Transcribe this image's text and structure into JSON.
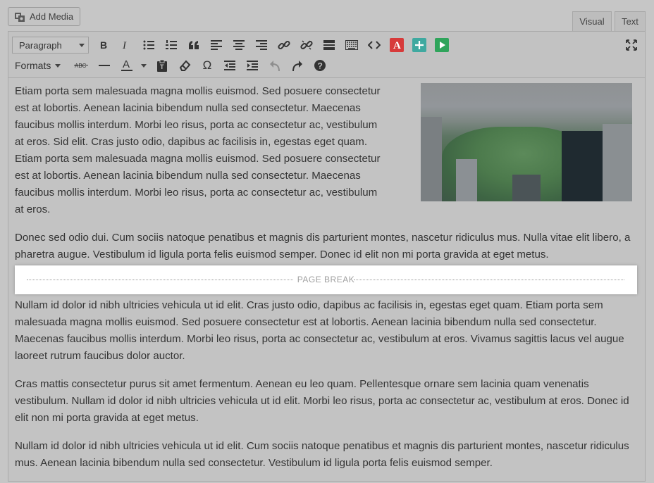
{
  "add_media": {
    "label": "Add Media",
    "icon": "media-icon"
  },
  "tabs": [
    {
      "label": "Visual"
    },
    {
      "label": "Text"
    }
  ],
  "toolbar": {
    "format_select": "Paragraph",
    "formats_label": "Formats",
    "row1_buttons": [
      "bold-icon",
      "italic-icon",
      "bulleted-list-icon",
      "numbered-list-icon",
      "blockquote-icon",
      "align-left-icon",
      "align-center-icon",
      "align-right-icon",
      "insert-link-icon",
      "remove-link-icon",
      "read-more-icon",
      "toolbar-toggle-icon",
      "code-icon",
      "adobe-icon",
      "add-icon",
      "play-icon",
      "fullscreen-icon"
    ],
    "row2_buttons": [
      "strikethrough-icon",
      "horizontal-line-icon",
      "text-color-icon",
      "paste-text-icon",
      "clear-formatting-icon",
      "special-character-icon",
      "decrease-indent-icon",
      "increase-indent-icon",
      "undo-icon",
      "redo-icon",
      "help-icon"
    ],
    "strike_label": "ABC",
    "special_char": "Ω",
    "text_color_letter": "A",
    "adobe_letter": "A"
  },
  "content": {
    "p1_lines": [
      "Etiam porta sem malesuada magna mollis euismod. Sed posuere consectetur",
      "est at lobortis. Aenean lacinia bibendum nulla sed consectetur. Maecenas",
      "faucibus mollis interdum. Morbi leo risus, porta ac consectetur ac, vestibulum",
      "at eros. Sid elit. Cras justo odio, dapibus ac facilisis in, egestas eget quam.",
      "Etiam porta sem malesuada magna mollis euismod. Sed posuere consectetur",
      "est at lobortis. Aenean lacinia bibendum nulla sed consectetur. Maecenas",
      "faucibus mollis interdum. Morbi leo risus, porta ac consectetur ac, vestibulum",
      "at eros."
    ],
    "p2": "Donec sed odio dui. Cum sociis natoque penatibus et magnis dis parturient montes, nascetur ridiculus mus. Nulla vitae elit libero, a pharetra augue. Vestibulum id ligula porta felis euismod semper. Donec id elit non mi porta gravida at eget metus.",
    "page_break_label": "PAGE BREAK",
    "p3": "Nullam id dolor id nibh ultricies vehicula ut id elit. Cras justo odio, dapibus ac facilisis in, egestas eget quam. Etiam porta sem malesuada magna mollis euismod. Sed posuere consectetur est at lobortis. Aenean lacinia bibendum nulla sed consectetur. Maecenas faucibus mollis interdum. Morbi leo risus, porta ac consectetur ac, vestibulum at eros. Vivamus sagittis lacus vel augue laoreet rutrum faucibus dolor auctor.",
    "p4": "Cras mattis consectetur purus sit amet fermentum. Aenean eu leo quam. Pellentesque ornare sem lacinia quam venenatis vestibulum. Nullam id dolor id nibh ultricies vehicula ut id elit. Morbi leo risus, porta ac consectetur ac, vestibulum at eros. Donec id elit non mi porta gravida at eget metus.",
    "p5": "Nullam id dolor id nibh ultricies vehicula ut id elit. Cum sociis natoque penatibus et magnis dis parturient montes, nascetur ridiculus mus. Aenean lacinia bibendum nulla sed consectetur. Vestibulum id ligula porta felis euismod semper."
  },
  "colors": {
    "adobe": "#d73a3a",
    "add": "#3fa9a0",
    "play": "#2fa45b"
  }
}
